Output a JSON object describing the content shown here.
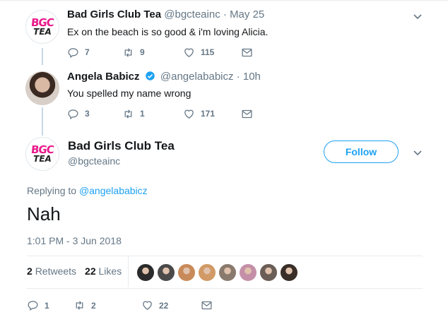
{
  "colors": {
    "accent": "#1da1f2",
    "muted": "#657786",
    "text": "#14171a",
    "divider": "#e6ecf0",
    "thread_line": "#c4d9e8",
    "bgc_pink": "#e8198b"
  },
  "avatar_logo": {
    "line1": "BGC",
    "line2": "TEA"
  },
  "tweet1": {
    "name": "Bad Girls Club Tea",
    "handle": "@bgcteainc",
    "separator": "·",
    "time": "May 25",
    "text": "Ex on the beach is so good & i'm loving Alicia.",
    "replies": "7",
    "retweets": "9",
    "likes": "115",
    "icons": [
      "reply-icon",
      "retweet-icon",
      "heart-icon",
      "message-icon",
      "chevron-down-icon"
    ]
  },
  "tweet2": {
    "name": "Angela Babicz",
    "verified": true,
    "handle": "@angelababicz",
    "separator": "·",
    "time": "10h",
    "text": "You spelled my name wrong",
    "replies": "3",
    "retweets": "1",
    "likes": "171"
  },
  "focused": {
    "name": "Bad Girls Club Tea",
    "handle": "@bgcteainc",
    "follow_label": "Follow",
    "replying_to_prefix": "Replying to ",
    "replying_to_handle": "@angelababicz",
    "text": "Nah",
    "timestamp": "1:01 PM - 3 Jun 2018",
    "retweets_count": "2",
    "retweets_label": "Retweets",
    "likes_count": "22",
    "likes_label": "Likes",
    "liker_avatar_colors": [
      "#2b2b2b",
      "#4a4a4a",
      "#c98a5a",
      "#d19a66",
      "#8a7a6e",
      "#c58fa8",
      "#6b5e57",
      "#3a2e28"
    ],
    "replies": "1",
    "retweets": "2",
    "likes": "22"
  }
}
